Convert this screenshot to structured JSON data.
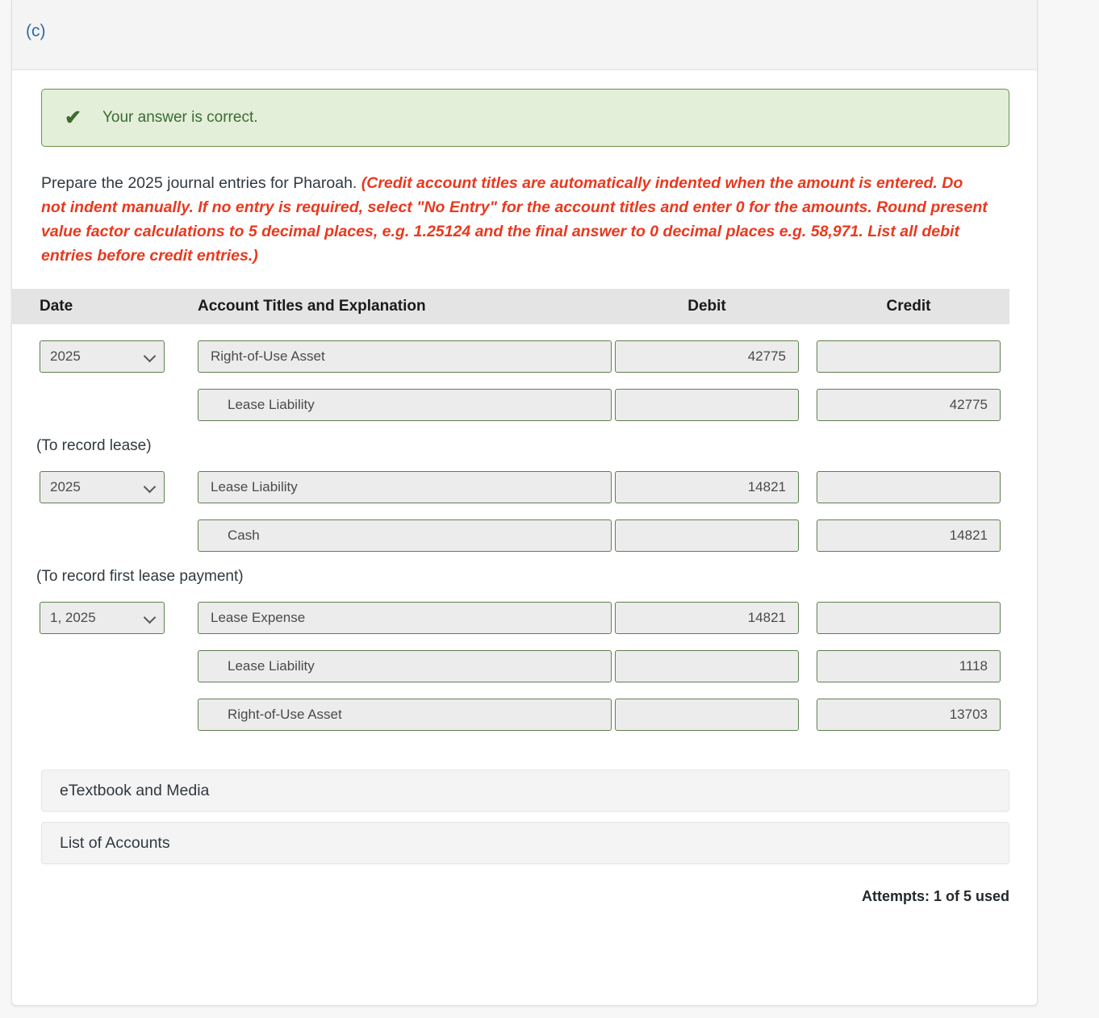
{
  "part": {
    "label": "(c)"
  },
  "banner": {
    "icon": "check-icon",
    "text": "Your answer is correct.",
    "bg_color": "#e3efd9",
    "border_color": "#6a9150",
    "text_color": "#3c6a33"
  },
  "instructions": {
    "plain": "Prepare the 2025 journal entries for Pharoah. ",
    "emphasis": "(Credit account titles are automatically indented when the amount is entered. Do not indent manually. If no entry is required, select \"No Entry\" for the account titles and enter 0 for the amounts. Round present value factor calculations to 5 decimal places, e.g. 1.25124 and the final answer to 0 decimal places e.g. 58,971. List all debit entries before credit entries.)",
    "emphasis_color": "#e8391f"
  },
  "table": {
    "headers": {
      "date": "Date",
      "account": "Account Titles and Explanation",
      "debit": "Debit",
      "credit": "Credit"
    },
    "rows": [
      {
        "date": "2025",
        "account": "Right-of-Use Asset",
        "indent": 0,
        "debit": "42775",
        "credit": ""
      },
      {
        "date": "",
        "account": "Lease Liability",
        "indent": 1,
        "debit": "",
        "credit": "42775"
      },
      {
        "explanation": "(To record lease)"
      },
      {
        "date": "2025",
        "account": "Lease Liability",
        "indent": 0,
        "debit": "14821",
        "credit": ""
      },
      {
        "date": "",
        "account": "Cash",
        "indent": 1,
        "debit": "",
        "credit": "14821"
      },
      {
        "explanation": "(To record first lease payment)"
      },
      {
        "date": "1, 2025",
        "account": "Lease Expense",
        "indent": 0,
        "debit": "14821",
        "credit": ""
      },
      {
        "date": "",
        "account": "Lease Liability",
        "indent": 1,
        "debit": "",
        "credit": "1118"
      },
      {
        "date": "",
        "account": "Right-of-Use Asset",
        "indent": 1,
        "debit": "",
        "credit": "13703"
      }
    ]
  },
  "footer": {
    "etextbook_label": "eTextbook and Media",
    "list_of_accounts_label": "List of Accounts",
    "attempts": "Attempts: 1 of 5 used"
  }
}
